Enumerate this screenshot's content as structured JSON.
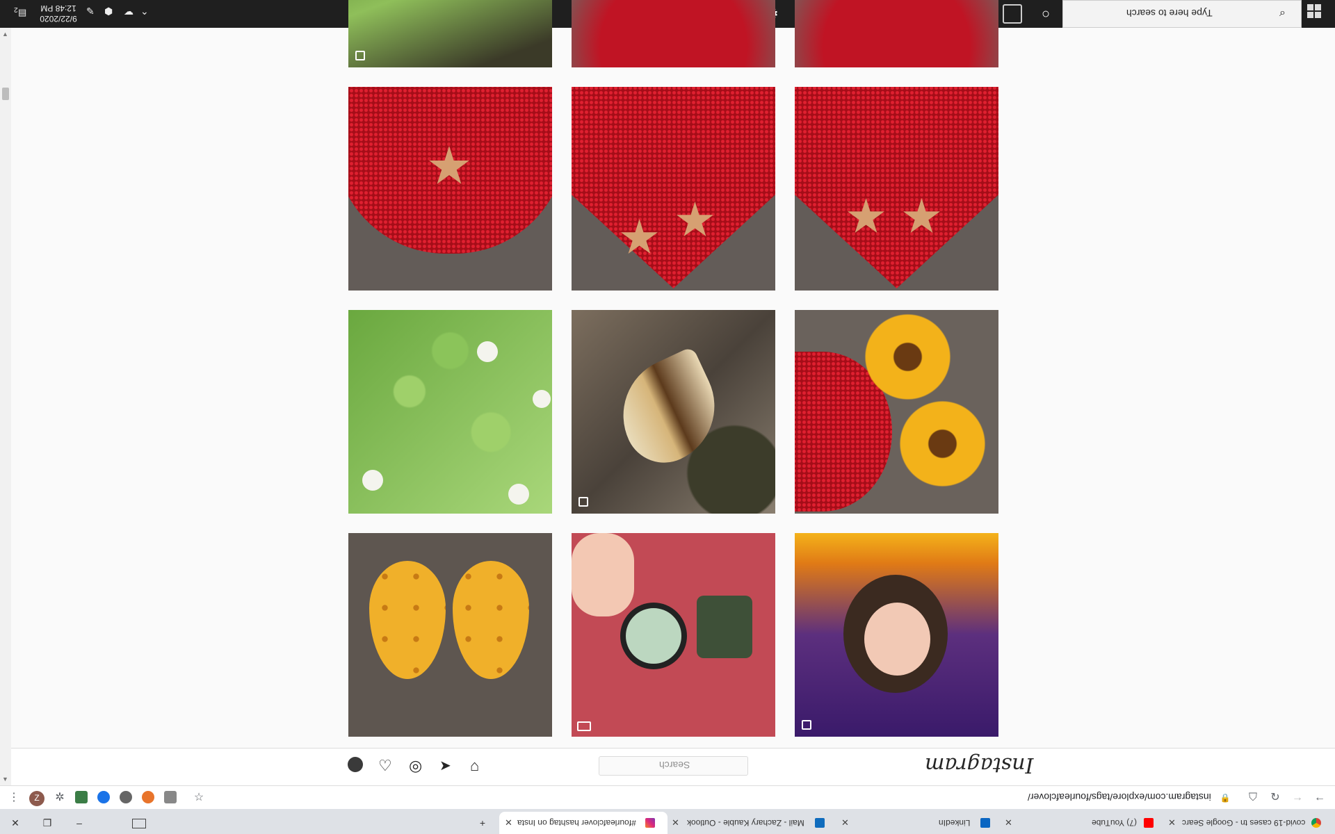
{
  "taskbar": {
    "search_placeholder": "Type here to search",
    "clock_time": "12:48 PM",
    "clock_date": "9/22/2020",
    "notification_count": "2"
  },
  "instagram": {
    "logo": "Instagram",
    "search_placeholder": "Search"
  },
  "browser": {
    "url": "instagram.com/explore/tags/fourleafclover/",
    "profile_letter": "Z",
    "tabs": [
      {
        "title": "covid-19 cases tn - Google Searc"
      },
      {
        "title": "(7) YouTube"
      },
      {
        "title": "LinkedIn"
      },
      {
        "title": "Mail - Zachary Kauble - Outlook"
      },
      {
        "title": "#fourleafclover hashtag on Insta"
      }
    ]
  },
  "grid": {
    "tiles": [
      {
        "name": "clover-grass-partial",
        "badge": "multi"
      },
      {
        "name": "red-heart-partial",
        "badge": ""
      },
      {
        "name": "red-heart-partial-2",
        "badge": ""
      },
      {
        "name": "red-heart-star-necklace",
        "badge": ""
      },
      {
        "name": "red-heart-two-stars",
        "badge": ""
      },
      {
        "name": "red-heart-two-stars-2",
        "badge": ""
      },
      {
        "name": "clover-patch",
        "badge": ""
      },
      {
        "name": "butterfly-wing-on-rock",
        "badge": "multi"
      },
      {
        "name": "sunflower-earrings-heart",
        "badge": ""
      },
      {
        "name": "sunflower-teardrop-earrings",
        "badge": ""
      },
      {
        "name": "magnifying-glass-clovers",
        "badge": "video"
      },
      {
        "name": "cartoon-girl-portrait",
        "badge": "multi"
      }
    ]
  },
  "colors": {
    "taskbar_bg": "#1f1f1f",
    "page_bg": "#fafafa",
    "heart_red": "#d3141f",
    "clover_green": "#7dbb52",
    "sunflower_yellow": "#f3b21a"
  }
}
